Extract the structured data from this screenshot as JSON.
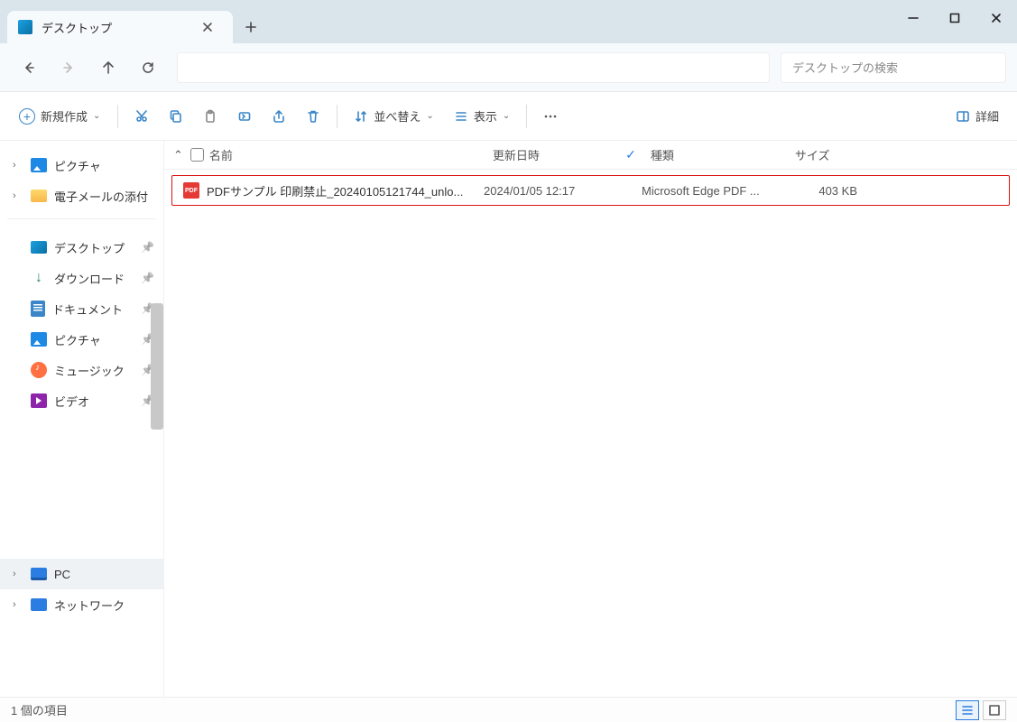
{
  "titlebar": {
    "tab_title": "デスクトップ"
  },
  "nav": {
    "search_placeholder": "デスクトップの検索"
  },
  "toolbar": {
    "new_label": "新規作成",
    "sort_label": "並べ替え",
    "view_label": "表示",
    "details_label": "詳細"
  },
  "sidebar": {
    "tree": [
      {
        "label": "ピクチャ",
        "icon": "pic",
        "chevron": true
      },
      {
        "label": "電子メールの添付",
        "icon": "folder",
        "chevron": true
      }
    ],
    "quick": [
      {
        "label": "デスクトップ",
        "icon": "desk"
      },
      {
        "label": "ダウンロード",
        "icon": "dl"
      },
      {
        "label": "ドキュメント",
        "icon": "doc"
      },
      {
        "label": "ピクチャ",
        "icon": "pic"
      },
      {
        "label": "ミュージック",
        "icon": "music"
      },
      {
        "label": "ビデオ",
        "icon": "vid"
      }
    ],
    "bottom": [
      {
        "label": "PC",
        "icon": "pc",
        "selected": true
      },
      {
        "label": "ネットワーク",
        "icon": "net"
      }
    ]
  },
  "columns": {
    "name": "名前",
    "date": "更新日時",
    "type": "種類",
    "size": "サイズ"
  },
  "rows": [
    {
      "name": "PDFサンプル 印刷禁止_20240105121744_unlo...",
      "date": "2024/01/05 12:17",
      "type": "Microsoft Edge PDF ...",
      "size": "403 KB"
    }
  ],
  "status": {
    "count_label": "1 個の項目"
  }
}
